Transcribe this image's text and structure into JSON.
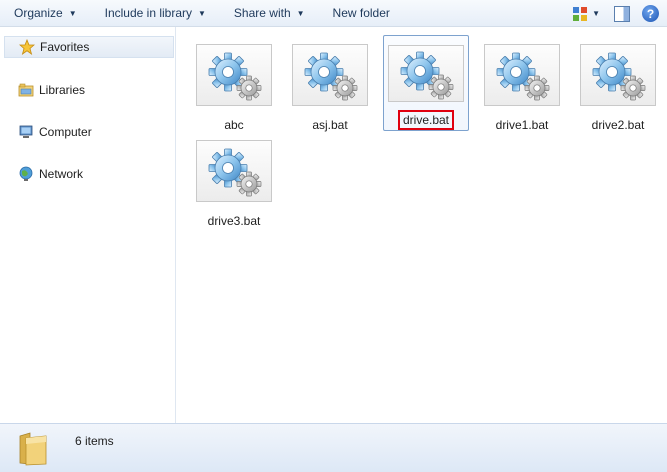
{
  "toolbar": {
    "organize": "Organize",
    "include_in_library": "Include in library",
    "share_with": "Share with",
    "new_folder": "New folder",
    "dropdown_arrow": "▼",
    "help": "?"
  },
  "nav": {
    "items": [
      {
        "label": "Favorites",
        "icon": "star-icon"
      },
      {
        "label": "Libraries",
        "icon": "library-icon"
      },
      {
        "label": "Computer",
        "icon": "computer-icon"
      },
      {
        "label": "Network",
        "icon": "network-icon"
      }
    ]
  },
  "files": [
    {
      "name": "abc",
      "icon": "batch-gear-icon"
    },
    {
      "name": "asj.bat",
      "icon": "batch-gear-icon"
    },
    {
      "name": "drive.bat",
      "icon": "batch-gear-icon",
      "selected": true
    },
    {
      "name": "drive1.bat",
      "icon": "batch-gear-icon"
    },
    {
      "name": "drive2.bat",
      "icon": "batch-gear-icon"
    },
    {
      "name": "drive3.bat",
      "icon": "batch-gear-icon"
    }
  ],
  "status": {
    "count": "6 items"
  },
  "colors": {
    "toolbar_text": "#1e395b",
    "highlight_box": "#e00010",
    "selection_border": "#7da2ce"
  }
}
